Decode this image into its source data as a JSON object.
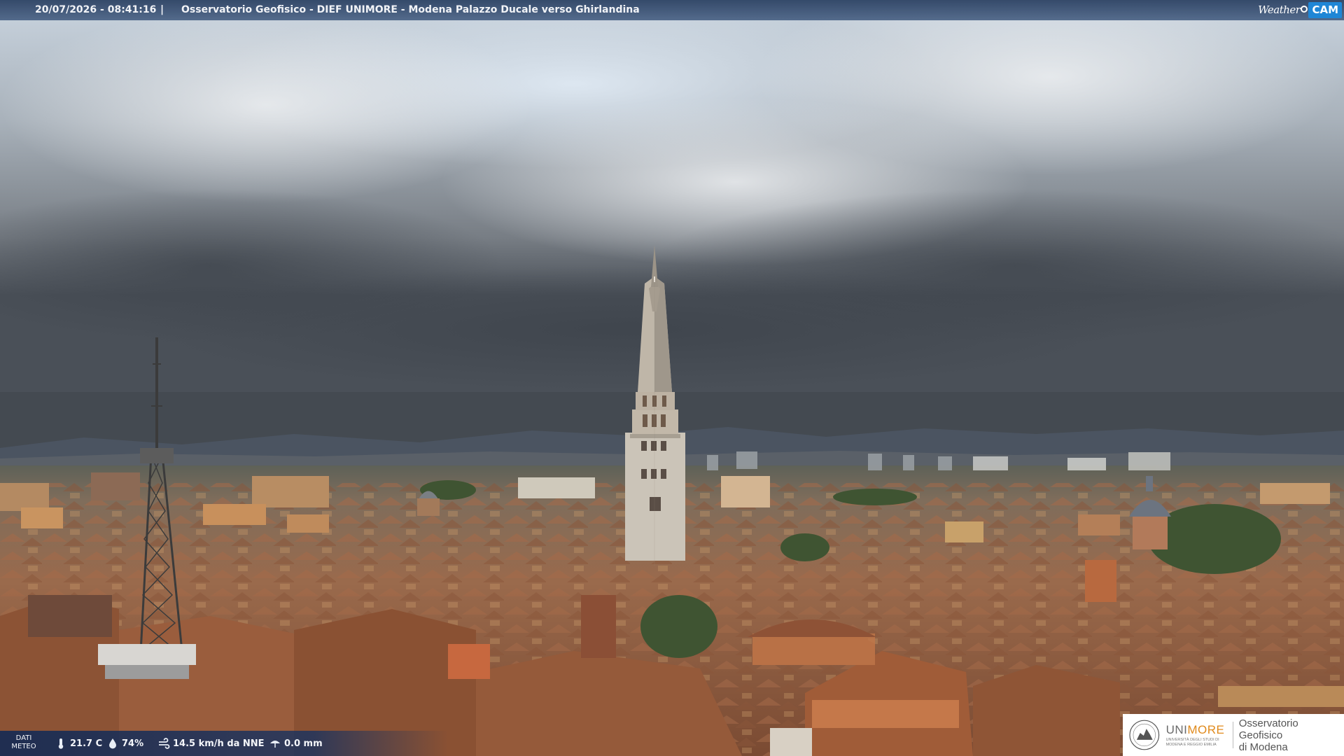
{
  "header": {
    "datetime": "20/07/2026 - 08:41:16",
    "separator": "|",
    "title": "Osservatorio Geofisico - DIEF UNIMORE - Modena Palazzo Ducale verso Ghirlandina",
    "logo_weather": "Weather",
    "logo_cam": "CAM"
  },
  "weather": {
    "label_line1": "DATI",
    "label_line2": "METEO",
    "temperature": "21.7 C",
    "humidity": "74%",
    "wind": "14.5 km/h da NNE",
    "rain": "0.0 mm",
    "icons": [
      "thermometer-icon",
      "humidity-icon",
      "wind-icon",
      "rain-icon"
    ]
  },
  "badge": {
    "uni_prefix": "UNI",
    "uni_suffix": "MORE",
    "uni_sub_1": "UNIVERSITÀ DEGLI STUDI DI",
    "uni_sub_2": "MODENA E REGGIO EMILIA",
    "obs_line1": "Osservatorio Geofisico",
    "obs_line2": "di Modena"
  },
  "colors": {
    "bar": "#2e4a78",
    "accent": "#1f86d6",
    "unimore_orange": "#e08a1c"
  }
}
